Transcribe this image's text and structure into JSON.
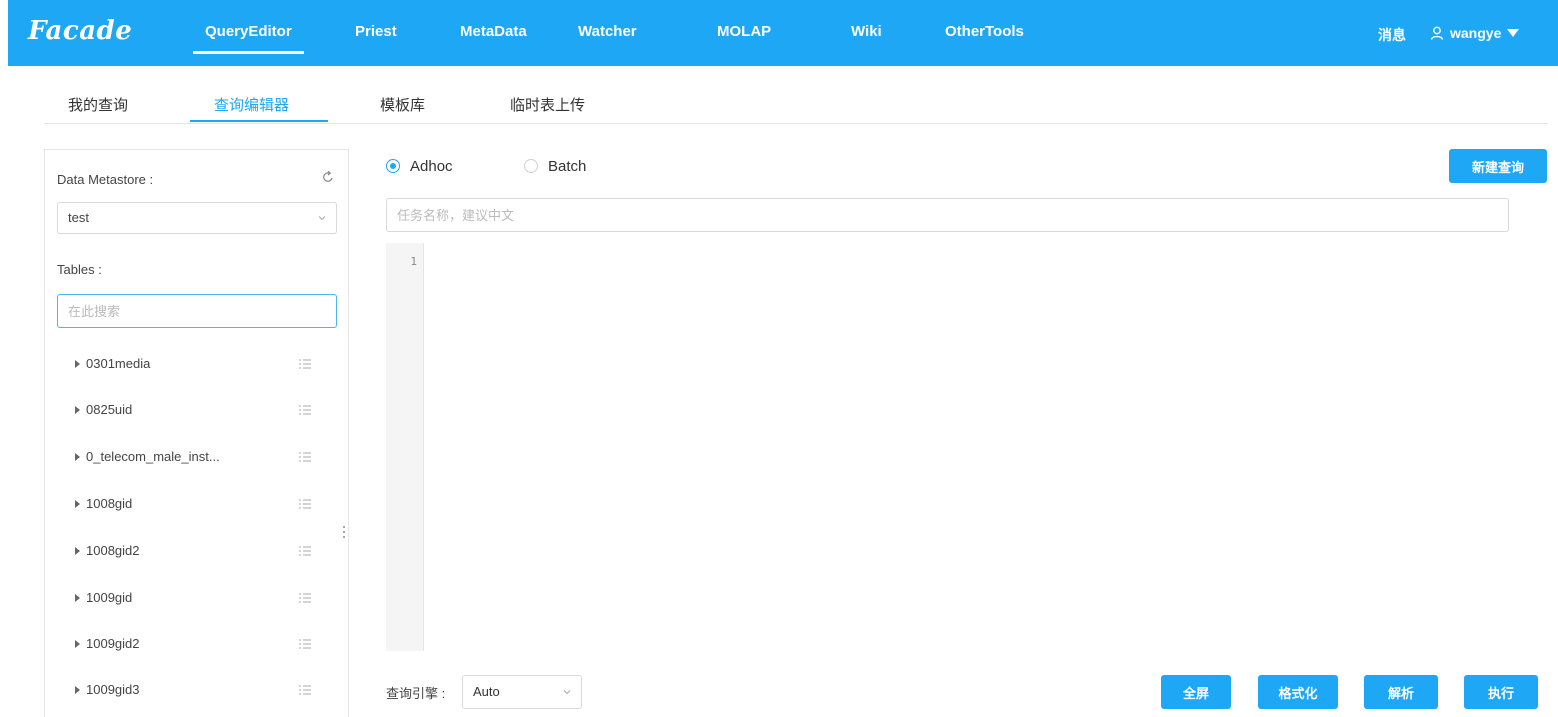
{
  "topnav": {
    "logo": "Facade",
    "items": [
      {
        "label": "QueryEditor",
        "active": true
      },
      {
        "label": "Priest"
      },
      {
        "label": "MetaData"
      },
      {
        "label": "Watcher"
      },
      {
        "label": "MOLAP"
      },
      {
        "label": "Wiki"
      },
      {
        "label": "OtherTools"
      }
    ],
    "messages": "消息",
    "username": "wangye",
    "user_icon": "user-icon",
    "caret_icon": "caret-down-icon"
  },
  "subtabs": [
    {
      "label": "我的查询"
    },
    {
      "label": "查询编辑器",
      "active": true
    },
    {
      "label": "模板库"
    },
    {
      "label": "临时表上传"
    }
  ],
  "left_panel": {
    "metastore_label": "Data Metastore :",
    "metastore_value": "test",
    "tables_label": "Tables :",
    "search_placeholder": "在此搜索",
    "tables": [
      "0301media",
      "0825uid",
      "0_telecom_male_inst...",
      "1008gid",
      "1008gid2",
      "1009gid",
      "1009gid2",
      "1009gid3"
    ]
  },
  "editor": {
    "modes": [
      {
        "label": "Adhoc",
        "checked": true
      },
      {
        "label": "Batch",
        "checked": false
      }
    ],
    "new_query_button": "新建查询",
    "task_name_placeholder": "任务名称，建议中文",
    "line_numbers": [
      "1"
    ],
    "code": "",
    "engine_label": "查询引擎 :",
    "engine_value": "Auto",
    "buttons": {
      "fullscreen": "全屏",
      "format": "格式化",
      "parse": "解析",
      "execute": "执行"
    }
  },
  "colors": {
    "primary": "#1da7f5",
    "border": "#d9d9d9"
  }
}
